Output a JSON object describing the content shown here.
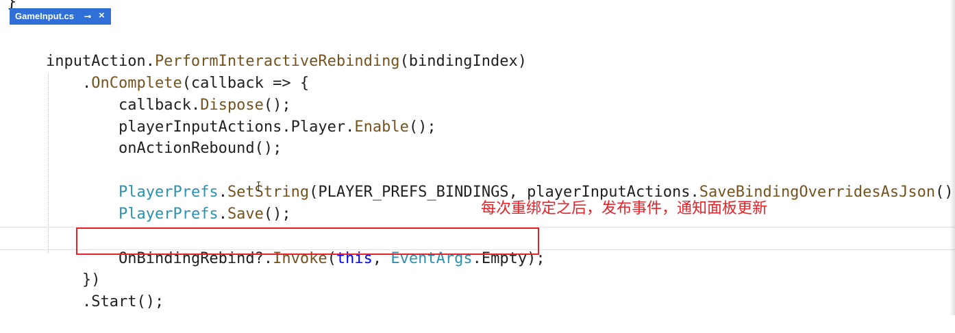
{
  "editor": {
    "fragment_above": "}",
    "tab": {
      "title": "GameInput.cs",
      "pin_icon": "pin-icon",
      "close_icon": "close-icon",
      "pin_glyph": "⊸",
      "close_glyph": "×"
    }
  },
  "code": {
    "line1": {
      "obj": "inputAction",
      "dot": ".",
      "method": "PerformInteractiveRebinding",
      "rest": "(bindingIndex)"
    },
    "line2": {
      "dot": ".",
      "method": "OnComplete",
      "rest": "(callback => {"
    },
    "line3": {
      "obj": "callback",
      "dot": ".",
      "method": "Dispose",
      "rest": "();"
    },
    "line4": {
      "obj": "playerInputActions",
      "dot1": ".",
      "prop": "Player",
      "dot2": ".",
      "method": "Enable",
      "rest": "();"
    },
    "line5": {
      "method": "onActionRebound",
      "rest": "();"
    },
    "line6": {
      "type": "PlayerPrefs",
      "dot1": ".",
      "method": "SetString",
      "open": "(",
      "const": "PLAYER_PREFS_BINDINGS",
      "comma": ", ",
      "obj": "playerInputActions",
      "dot2": ".",
      "method2": "SaveBindingOverridesAsJson",
      "rest": "());"
    },
    "line7": {
      "type": "PlayerPrefs",
      "dot": ".",
      "method": "Save",
      "rest": "();"
    },
    "line8": {
      "event": "OnBindingRebind",
      "op": "?.",
      "method": "Invoke",
      "open": "(",
      "keyword": "this",
      "comma": ", ",
      "type": "EventArgs",
      "dot": ".",
      "prop": "Empty",
      "rest": ");"
    },
    "line9": {
      "text": "})"
    },
    "line10": {
      "dot": ".",
      "method": "Start",
      "rest": "();"
    }
  },
  "annotation": {
    "text": "每次重绑定之后，发布事件，通知面板更新",
    "color": "#e6232b"
  },
  "colors": {
    "tab_background": "#2f6fd6",
    "method": "#74531f",
    "type": "#2b91af",
    "keyword": "#0000ff",
    "highlight_box": "#e6232b"
  }
}
